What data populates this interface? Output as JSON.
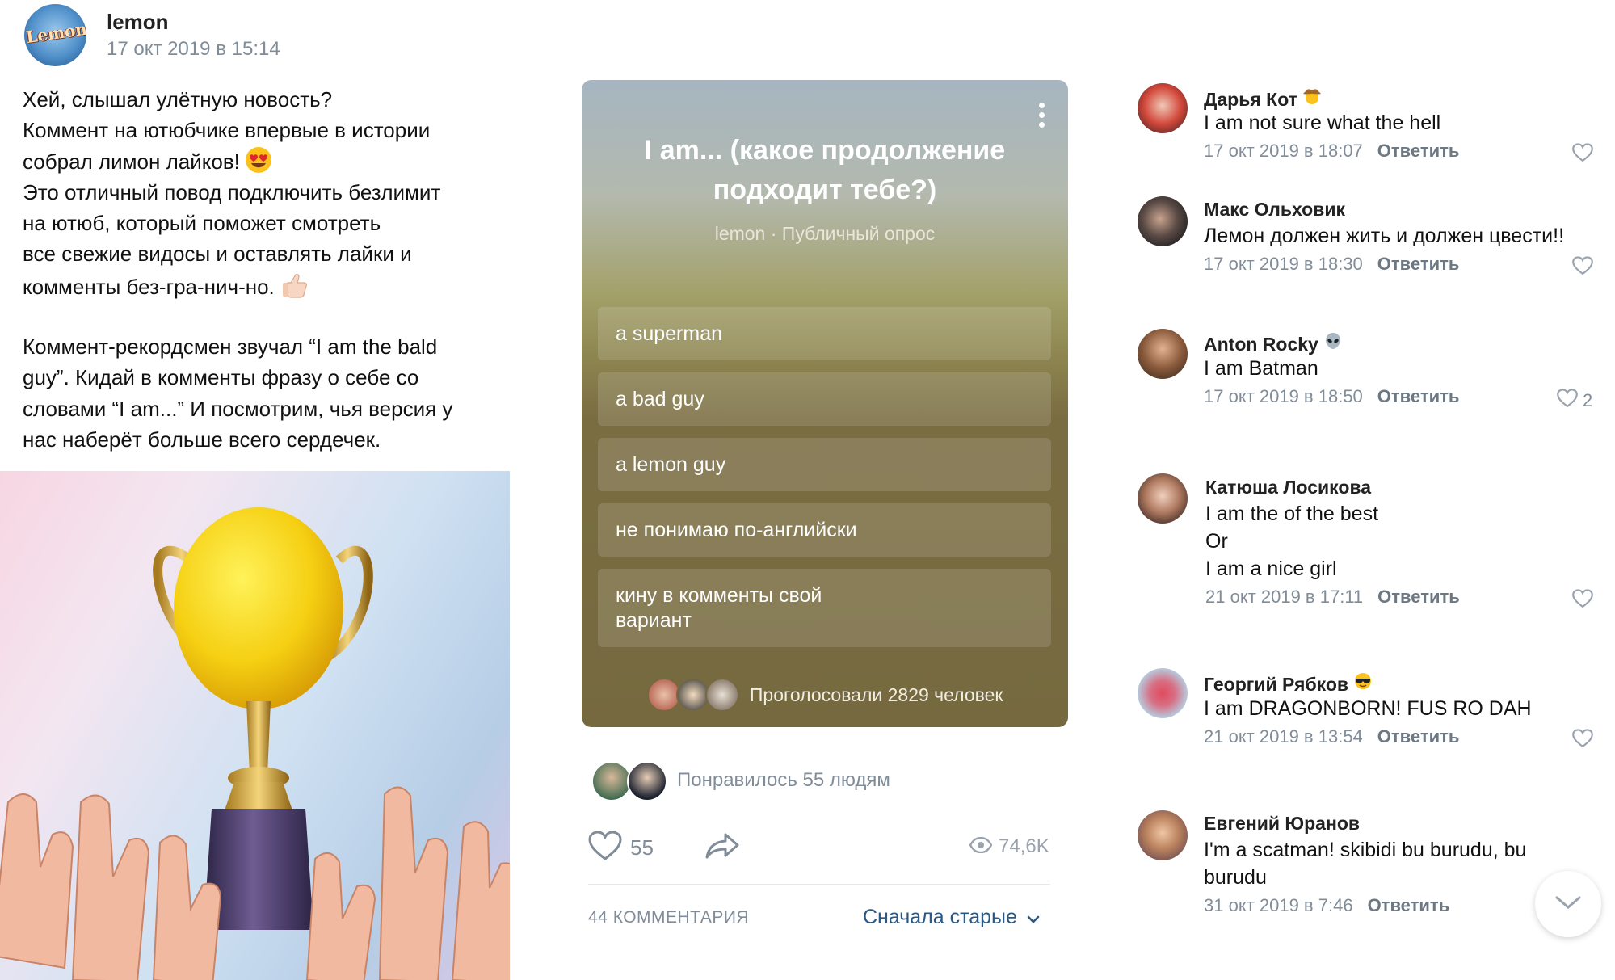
{
  "post": {
    "author": "lemon",
    "avatar_brand": "Lemon",
    "date": "17 окт 2019 в 15:14",
    "text_lines": [
      "Хей, слышал улётную новость?",
      "Коммент на ютюбчике впервые в истории",
      "собрал лимон лайков!",
      "Это отличный повод подключить безлимит",
      "на ютюб, который поможет смотреть",
      "все свежие видосы и оставлять лайки и",
      "комменты без-гра-нич-но.",
      "",
      "Коммент-рекордсмен звучал “I am the bald",
      "guy”. Кидай в комменты фразу о себе со",
      "словами “I am...” И посмотрим, чья версия у",
      "нас наберёт больше всего сердечек."
    ]
  },
  "poll": {
    "title": "I am... (какое продолжение подходит тебе?)",
    "subtitle": "lemon · Публичный опрос",
    "options": [
      "a superman",
      "a bad guy",
      "a lemon guy",
      "не понимаю по-английски",
      "кину в комменты свой вариант"
    ],
    "voters_text": "Проголосовали 2829 человек"
  },
  "reactions": {
    "liked_text": "Понравилось 55 людям",
    "like_count": "55",
    "views": "74,6K"
  },
  "comments_header": {
    "count_label": "44 КОММЕНТАРИЯ",
    "sort_label": "Сначала старые"
  },
  "reply_label": "Ответить",
  "comments": [
    {
      "name": "Дарья Кот",
      "text": [
        "I am not sure what the hell"
      ],
      "date": "17 окт 2019 в 18:07",
      "likes": ""
    },
    {
      "name": "Макс Ольховик",
      "text": [
        "Лемон должен жить и должен цвести!!"
      ],
      "date": "17 окт 2019 в 18:30",
      "likes": ""
    },
    {
      "name": "Anton Rocky",
      "text": [
        "I am Batman"
      ],
      "date": "17 окт 2019 в 18:50",
      "likes": "2"
    },
    {
      "name": "Катюша Лосикова",
      "text": [
        "I am the of the best",
        "Or",
        "I am a nice girl"
      ],
      "date": "21 окт 2019 в 17:11",
      "likes": ""
    },
    {
      "name": "Георгий Рябков",
      "text": [
        "I am DRAGONBORN! FUS RO DAH"
      ],
      "date": "21 окт 2019 в 13:54",
      "likes": ""
    },
    {
      "name": "Евгений Юранов",
      "text": [
        "I'm a scatman! skibidi bu burudu, bu",
        "burudu"
      ],
      "date": "31 окт 2019 в 7:46",
      "likes": ""
    }
  ],
  "colors": {
    "link": "#2a5885",
    "meta": "#818c99",
    "poll_bg": "#76693f"
  },
  "icons": [
    "smiling-face-heart-eyes-emoji",
    "thumbs-up-emoji",
    "cowboy-emoji",
    "alien-emoji",
    "sunglasses-emoji",
    "heart-icon",
    "share-icon",
    "eye-icon",
    "chevron-down-icon",
    "more-vertical-icon"
  ]
}
